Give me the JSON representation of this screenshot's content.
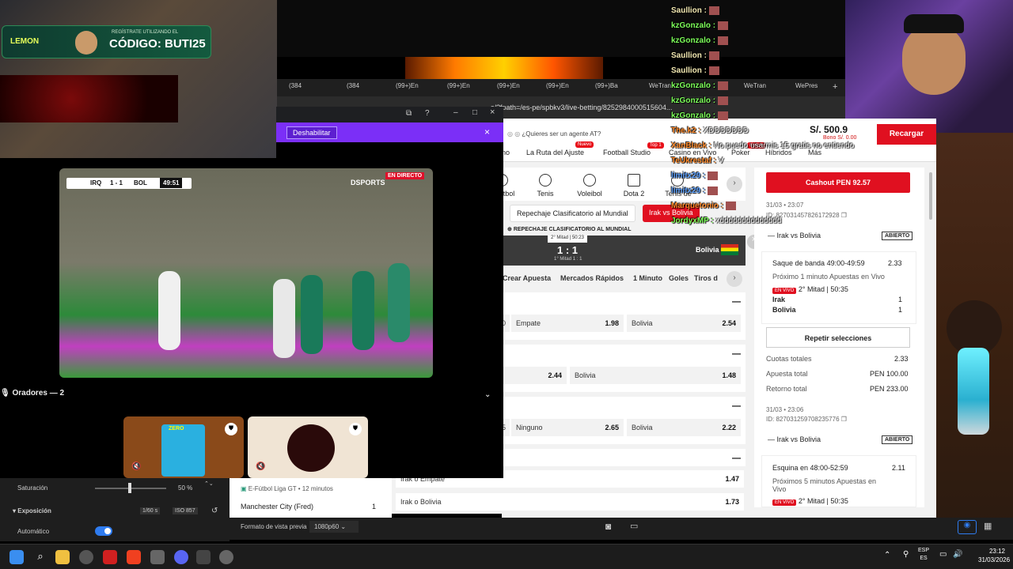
{
  "overlay": {
    "lemon_brand": "LEMON",
    "lemon_register": "REGÍSTRATE UTILIZANDO EL",
    "lemon_code": "CÓDIGO: BUTI25"
  },
  "browser": {
    "tabs": [
      "(384",
      "(384",
      "(99+)En",
      "(99+)En",
      "(99+)En",
      "(99+)En",
      "(99+)Ba",
      "WeTran",
      "WeTran",
      "WePres"
    ],
    "url": "s/?fpath=/es-pe/spbkv3/live-betting/8252984000515604..."
  },
  "site": {
    "agent_prompt": "¿Quieres ser un agente AT?",
    "balance": "S/. 500.9",
    "bonus": "Bono S/. 0.00",
    "recharge": "Recargar",
    "nav": [
      "no",
      "La Ruta del Ajuste",
      "Football Studio",
      "Casino en Vivo",
      "Poker",
      "Híbridos",
      "Más"
    ],
    "nav_badges": [
      "Nuevo",
      "Top 1",
      "Nuevo"
    ],
    "sports": [
      "tbol",
      "Tenis",
      "Voleibol",
      "Dota 2",
      "Tenis de"
    ],
    "pills": [
      "Repechaje Clasificatorio al Mundial",
      "Irak vs Bolivia"
    ],
    "competition": "REPECHAJE CLASIFICATORIO AL MUNDIAL",
    "match_period": "2° Mitad | 50:23",
    "score": "1 : 1",
    "first_half": "1° Mitad 1 : 1",
    "away_team": "Bolivia",
    "market_tabs": [
      "Crear Apuesta",
      "Mercados Rápidos",
      "1 Minuto",
      "Goles",
      "Tiros d"
    ],
    "markets": [
      {
        "left_label": "0",
        "mid_label": "Empate",
        "mid_odd": "1.98",
        "right_label": "Bolivia",
        "right_odd": "2.54"
      },
      {
        "left_odd": "2.44",
        "right_label": "Bolivia",
        "right_odd": "1.48"
      },
      {
        "left_label": "5",
        "mid_label": "Ninguno",
        "mid_odd": "2.65",
        "right_label": "Bolivia",
        "right_odd": "2.22"
      }
    ],
    "lower_odds": [
      {
        "label": "Irak o Empate",
        "odd": "1.47"
      },
      {
        "label": "Irak o Bolivia",
        "odd": "1.73"
      }
    ],
    "lower_list": {
      "sport_line": "E-Fútbol Liga GT • 12 minutos",
      "team": "Manchester City (Fred)",
      "num": "1"
    }
  },
  "betslip": {
    "cashout": "Cashout PEN 92.57",
    "bet1": {
      "date": "31/03 • 23:07",
      "id": "ID: 827031457826172928",
      "match": "Irak vs Bolivia",
      "status": "ABIERTO",
      "market": "Saque de banda 49:00-49:59",
      "odd": "2.33",
      "desc": "Próximo 1 minuto Apuestas en Vivo",
      "live": "EN VIVO",
      "time": "2° Mitad",
      "clock": "50:35",
      "team1": "Irak",
      "score1": "1",
      "team2": "Bolivia",
      "score2": "1"
    },
    "repeat": "Repetir selecciones",
    "totals": {
      "cuotas_label": "Cuotas totales",
      "cuotas": "2.33",
      "apuesta_label": "Apuesta total",
      "apuesta": "PEN 100.00",
      "retorno_label": "Retorno total",
      "retorno": "PEN 233.00"
    },
    "bet2": {
      "date": "31/03 • 23:06",
      "id": "ID: 827031259708235776",
      "match": "Irak vs Bolivia",
      "status": "ABIERTO",
      "market": "Esquina en 48:00-52:59",
      "odd": "2.11",
      "desc": "Próximos 5 minutos Apuestas en Vivo",
      "live": "EN VIVO",
      "time": "2° Mitad",
      "clock": "50:35"
    }
  },
  "discord": {
    "disable": "Deshabilitar",
    "speakers": "Oradores — 2",
    "score_home": "IRQ",
    "score": "1 - 1",
    "score_away": "BOL",
    "match_clock": "49:51",
    "live_badge": "EN DIRECTO",
    "broadcaster": "DSPORTS",
    "tile_name": "ZERO"
  },
  "obs": {
    "saturation_label": "Saturación",
    "saturation_value": "50 %",
    "exposure_label": "Exposición",
    "shutter": "1/60 s",
    "iso": "ISO 857",
    "auto_label": "Automático",
    "preview_label": "Formato de vista previa",
    "preview_value": "1080p60"
  },
  "chat": [
    {
      "user": "Saullion",
      "msg": "",
      "color": "#f0e6b0"
    },
    {
      "user": "kzGonzalo",
      "msg": "",
      "color": "#7dff5a"
    },
    {
      "user": "kzGonzalo",
      "msg": "",
      "color": "#7dff5a"
    },
    {
      "user": "Saullion",
      "msg": "",
      "color": "#f0e6b0"
    },
    {
      "user": "Saullion",
      "msg": "",
      "color": "#f0e6b0"
    },
    {
      "user": "kzGonzalo",
      "msg": "",
      "color": "#7dff5a"
    },
    {
      "user": "kzGonzalo",
      "msg": "",
      "color": "#7dff5a"
    },
    {
      "user": "kzGonzalo",
      "msg": "",
      "color": "#7dff5a"
    },
    {
      "user": "The.k2",
      "msg": "XDDDDDDD",
      "color": "#ff8a2a"
    },
    {
      "user": "XanBlack",
      "msg": "No puedo usarmis 15 gratis no entiendo",
      "color": "#ff8a2a"
    },
    {
      "user": "TeUkrestaf",
      "msg": "V",
      "color": "#ff8a2a"
    },
    {
      "user": "limitx29",
      "msg": "",
      "color": "#5aa0ff"
    },
    {
      "user": "limitx29",
      "msg": "",
      "color": "#5aa0ff"
    },
    {
      "user": "Marquetonio",
      "msg": "",
      "color": "#ff8a2a"
    },
    {
      "user": "JordyxMP",
      "msg": "xdddddddddddddd",
      "color": "#7dff5a"
    }
  ],
  "taskbar": {
    "lang": "ESP",
    "region": "ES",
    "time": "23:12",
    "date": "31/03/2026"
  },
  "colors": {
    "accent_red": "#e01020",
    "discord_purple": "#7b2ff7"
  }
}
